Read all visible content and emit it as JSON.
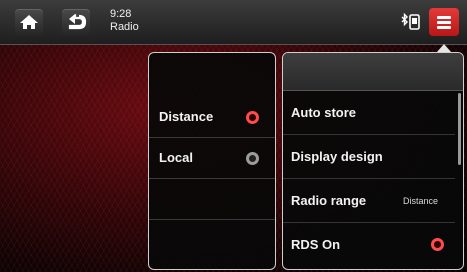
{
  "status": {
    "time": "9:28",
    "source": "Radio"
  },
  "left_panel": {
    "options": [
      {
        "label": "Distance",
        "selected": true
      },
      {
        "label": "Local",
        "selected": false
      }
    ]
  },
  "right_menu": {
    "items": [
      {
        "label": "Auto store",
        "value": ""
      },
      {
        "label": "Display design",
        "value": ""
      },
      {
        "label": "Radio range",
        "value": "Distance"
      },
      {
        "label": "RDS On",
        "value": ""
      }
    ]
  },
  "icons": {
    "home": "home-icon",
    "back": "back-icon",
    "phone": "phone-bluetooth-icon",
    "menu": "menu-icon"
  },
  "colors": {
    "accent": "#e02b2b",
    "radio_selected": "#ff4b4b",
    "radio_unselected": "#9c9c9c"
  }
}
